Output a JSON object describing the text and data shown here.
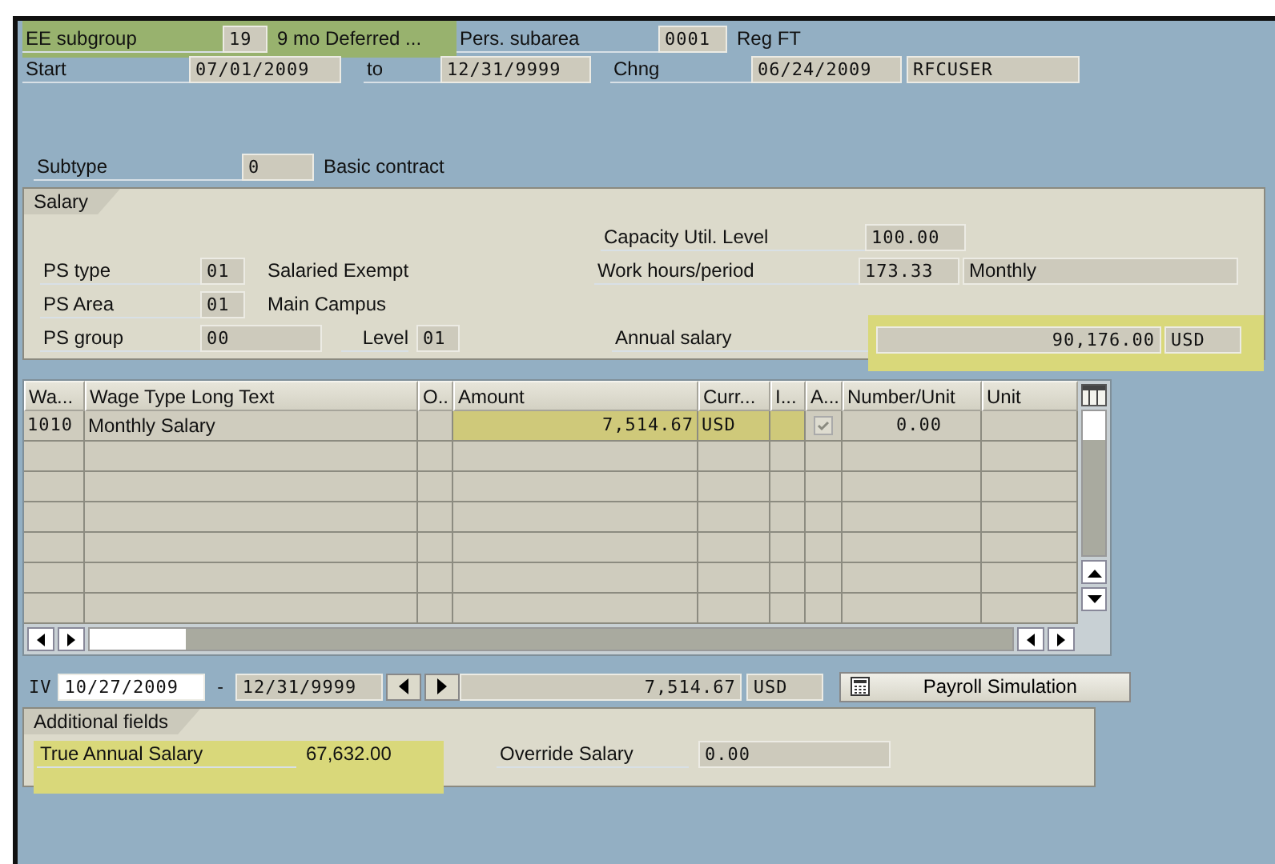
{
  "header": {
    "ee_subgroup": {
      "label": "EE subgroup",
      "code": "19",
      "text": "9 mo Deferred ...",
      "highlighted": true
    },
    "pers_subarea": {
      "label": "Pers. subarea",
      "code": "0001",
      "text": "Reg FT"
    },
    "start": {
      "label": "Start",
      "from": "07/01/2009",
      "to_label": "to",
      "to": "12/31/9999"
    },
    "chng": {
      "label": "Chng",
      "date": "06/24/2009",
      "user": "RFCUSER"
    }
  },
  "subtype": {
    "label": "Subtype",
    "code": "0",
    "text": "Basic contract"
  },
  "salary": {
    "tab": "Salary",
    "capacity": {
      "label": "Capacity Util. Level",
      "value": "100.00"
    },
    "ps_type": {
      "label": "PS type",
      "code": "01",
      "text": "Salaried Exempt"
    },
    "work_hours": {
      "label": "Work hours/period",
      "value": "173.33",
      "unit": "Monthly"
    },
    "ps_area": {
      "label": "PS Area",
      "code": "01",
      "text": "Main Campus"
    },
    "ps_group": {
      "label": "PS group",
      "code": "00",
      "level_label": "Level",
      "level": "01"
    },
    "annual_salary": {
      "label": "Annual salary",
      "value": "90,176.00",
      "currency": "USD",
      "highlighted": true
    }
  },
  "table": {
    "columns": [
      "Wa...",
      "Wage Type Long Text",
      "O..",
      "Amount",
      "Curr...",
      "I...",
      "A...",
      "Number/Unit",
      "Unit"
    ],
    "rows": [
      {
        "wage_type": "1010",
        "long_text": "Monthly Salary",
        "amount": "7,514.67",
        "currency": "USD",
        "a_checked": true,
        "number_unit": "0.00",
        "highlighted": true
      }
    ]
  },
  "period": {
    "label": "IV",
    "from": "10/27/2009",
    "separator": "-",
    "to": "12/31/9999",
    "total": "7,514.67",
    "currency": "USD",
    "button": "Payroll Simulation"
  },
  "additional": {
    "tab": "Additional fields",
    "true_annual_salary": {
      "label": "True Annual Salary",
      "value": "67,632.00",
      "highlighted": true
    },
    "override_salary": {
      "label": "Override Salary",
      "value": "0.00"
    }
  }
}
